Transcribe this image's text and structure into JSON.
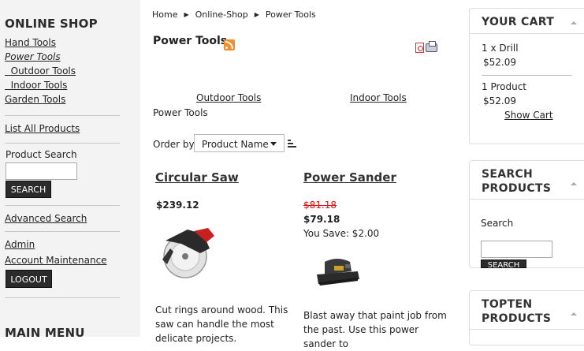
{
  "sidebar": {
    "title": "ONLINE SHOP",
    "categories": [
      "Hand Tools",
      "Power Tools",
      "  Outdoor Tools",
      "  Indoor Tools",
      "Garden Tools"
    ],
    "list_all": "List All Products",
    "search_label": "Product Search",
    "search_button": "SEARCH",
    "advanced_search": "Advanced Search",
    "admin": "Admin",
    "account": "Account Maintenance",
    "logout": "LOGOUT",
    "main_menu": "MAIN MENU"
  },
  "breadcrumb": [
    "Home",
    "Online-Shop",
    "Power Tools"
  ],
  "category": {
    "title": "Power Tools",
    "subcategories": [
      "Outdoor Tools",
      "Indoor Tools"
    ],
    "description": "Power Tools"
  },
  "sort": {
    "label": "Order by:",
    "selected": "Product Name"
  },
  "products": [
    {
      "name": "Circular Saw",
      "price": "$239.12",
      "description": "Cut rings around wood. This saw can handle the most delicate projects."
    },
    {
      "name": "Power Sander",
      "old_price": "$81.18",
      "price": "$79.18",
      "you_save": "You Save: $2.00",
      "description": "Blast away that paint job from the past. Use this power sander to"
    }
  ],
  "cart": {
    "title": "YOUR CART",
    "item": "1 x",
    "item_link": "Drill",
    "item_price": "$52.09",
    "summary": "1 Product",
    "total": "$52.09",
    "show_cart": "Show Cart"
  },
  "search_panel": {
    "title_line1": "SEARCH",
    "title_line2": "PRODUCTS",
    "label": "Search",
    "button": "SEARCH"
  },
  "topten": {
    "title_line1": "TOPTEN",
    "title_line2": "PRODUCTS"
  }
}
